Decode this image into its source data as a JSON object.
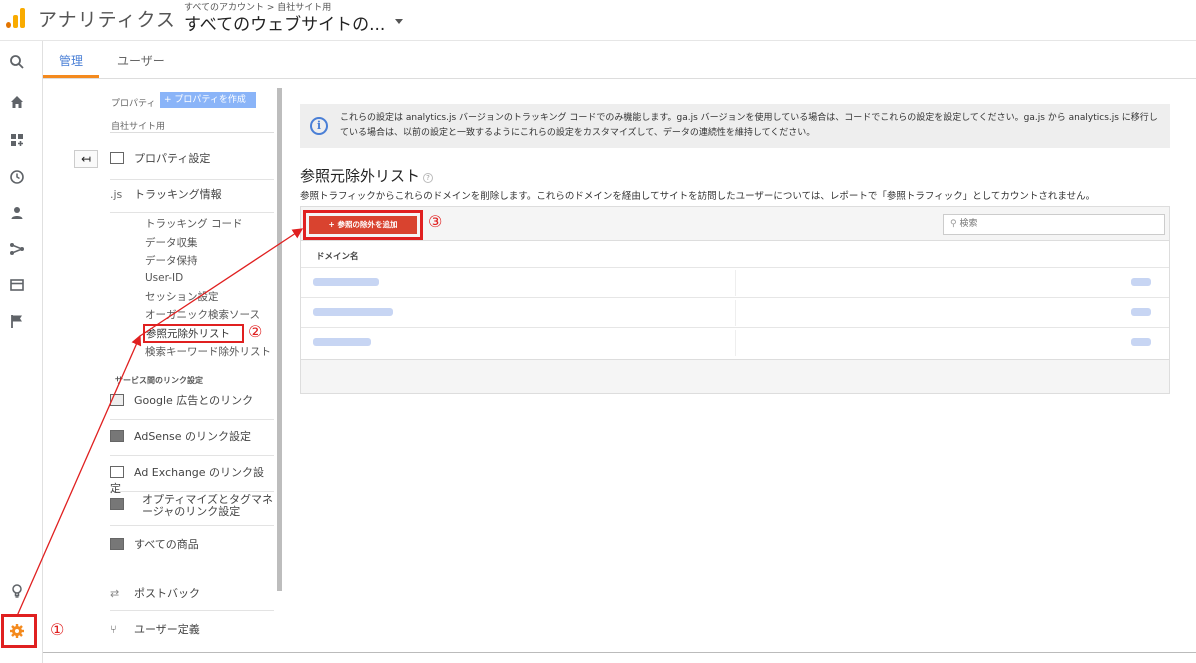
{
  "header": {
    "app_title": "アナリティクス",
    "breadcrumb": "すべてのアカウント > 自社サイト用",
    "view_name": "すべてのウェブサイトの..."
  },
  "tabs": [
    {
      "label": "管理"
    },
    {
      "label": "ユーザー"
    }
  ],
  "property": {
    "column_label": "プロパティ",
    "create_button": "+ プロパティを作成",
    "selected": "自社サイト用"
  },
  "menu": {
    "property_settings": "プロパティ設定",
    "tracking_info_icon": ".js",
    "tracking_info": "トラッキング情報",
    "tracking_items": [
      "トラッキング コード",
      "データ収集",
      "データ保持",
      "User-ID",
      "セッション設定",
      "オーガニック検索ソース",
      "参照元除外リスト",
      "検索キーワード除外リスト"
    ],
    "service_links_heading": "サービス間のリンク設定",
    "links": [
      "Google 広告とのリンク",
      "AdSense のリンク設定",
      "Ad Exchange のリンク設定",
      "オプティマイズとタグマネージャのリンク設定",
      "すべての商品"
    ],
    "postback": "ポストバック",
    "user_definitions": "ユーザー定義"
  },
  "info": {
    "text": "これらの設定は analytics.js バージョンのトラッキング コードでのみ機能します。ga.js バージョンを使用している場合は、コードでこれらの設定を設定してください。ga.js から analytics.js に移行している場合は、以前の設定と一致するようにこれらの設定をカスタマイズして、データの連続性を維持してください。"
  },
  "page": {
    "title": "参照元除外リスト",
    "description": "参照トラフィックからこれらのドメインを削除します。これらのドメインを経由してサイトを訪問したユーザーについては、レポートで「参照トラフィック」としてカウントされません。"
  },
  "table": {
    "add_button": "+ 参照の除外を追加",
    "search_placeholder": "検索",
    "column_header": "ドメイン名",
    "rows": 3
  },
  "annotations": [
    "①",
    "②",
    "③"
  ],
  "colors": {
    "accent": "#4a7fd6",
    "tab_underline": "#f48a1e",
    "add_button": "#d9432f",
    "annotation_red": "#e02020",
    "logo": "#f9ab00"
  }
}
